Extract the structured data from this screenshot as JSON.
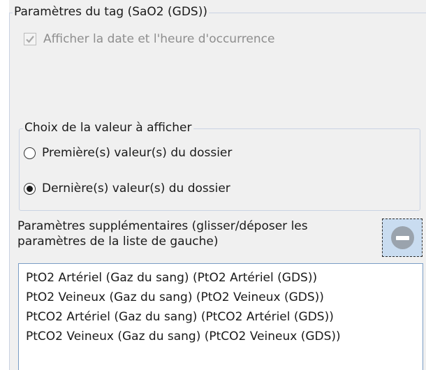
{
  "tag_group": {
    "title": "Paramètres du tag (SaO2 (GDS))"
  },
  "show_datetime": {
    "label": "Afficher la date et l'heure d'occurrence",
    "checked": true,
    "enabled": false
  },
  "value_choice": {
    "title": "Choix de la valeur à afficher",
    "options": [
      {
        "label": "Première(s) valeur(s) du dossier",
        "selected": false
      },
      {
        "label": "Dernière(s) valeur(s) du dossier",
        "selected": true
      }
    ]
  },
  "extra_params": {
    "label_line1": "Paramètres supplémentaires (glisser/déposer les",
    "label_line2": "paramètres de la liste de gauche)",
    "remove_icon": "minus-circle-icon",
    "items": [
      "PtO2 Artériel (Gaz du sang) (PtO2 Artériel (GDS))",
      "PtO2 Veineux (Gaz du sang) (PtO2 Veineux (GDS))",
      "PtCO2 Artériel (Gaz du sang) (PtCO2 Artériel (GDS))",
      "PtCO2 Veineux (Gaz du sang) (PtCO2 Veineux (GDS))"
    ]
  }
}
